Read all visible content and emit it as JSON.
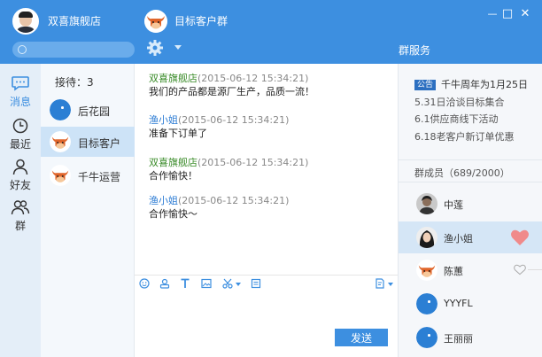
{
  "header": {
    "shop_name": "双喜旗舰店",
    "chat_title": "目标客户群",
    "group_service": "群服务",
    "window_controls": {
      "settings": "⚙",
      "minimize": "—",
      "maximize": "□",
      "close": "✕"
    }
  },
  "nav": {
    "items": [
      {
        "label": "消息",
        "icon": "message-icon"
      },
      {
        "label": "最近",
        "icon": "clock-icon"
      },
      {
        "label": "好友",
        "icon": "friend-icon"
      },
      {
        "label": "群",
        "icon": "group-icon"
      }
    ],
    "active_index": 0
  },
  "conversations": {
    "reception": "接待：3",
    "items": [
      {
        "label": "后花园",
        "avatar": "bird"
      },
      {
        "label": "目标客户",
        "avatar": "ox"
      },
      {
        "label": "千牛运营",
        "avatar": "ox"
      }
    ],
    "active_index": 1
  },
  "messages": [
    {
      "sender": "双喜旗舰店",
      "sender_type": "shop",
      "time": "(2015-06-12 15:34:21)",
      "text": "我们的产品都是源厂生产，品质一流！"
    },
    {
      "sender": "渔小姐",
      "sender_type": "user",
      "time": "(2015-06-12 15:34:21)",
      "text": "准备下订单了"
    },
    {
      "sender": "双喜旗舰店",
      "sender_type": "shop",
      "time": "(2015-06-12 15:34:21)",
      "text": "合作愉快！"
    },
    {
      "sender": "渔小姐",
      "sender_type": "user",
      "time": "(2015-06-12 15:34:21)",
      "text": "合作愉快～"
    }
  ],
  "composer": {
    "send_label": "发送",
    "tools": [
      "emoji-icon",
      "contact-card-icon",
      "text-format-icon",
      "image-icon",
      "screenshot-icon",
      "history-icon",
      "quick-phrase-icon"
    ]
  },
  "notice": {
    "badge": "公告",
    "title": "千牛周年为1月25日",
    "lines": [
      "5.31日洽谈目标集合",
      "6.1供应商线下活动",
      "6.18老客户新订单优惠"
    ]
  },
  "members": {
    "header": "群成员（689/2000）",
    "items": [
      {
        "name": "中莲",
        "avatar": "photo-man"
      },
      {
        "name": "渔小姐",
        "avatar": "photo-woman"
      },
      {
        "name": "陈蕙",
        "avatar": "ox"
      },
      {
        "name": "YYYFL",
        "avatar": "bird"
      },
      {
        "name": "王丽丽",
        "avatar": "bird"
      }
    ],
    "active_index": 1
  },
  "colors": {
    "primary": "#3d8fe0",
    "shop_name": "#3b8c2a",
    "user_name": "#2c7cd4",
    "heart": "#f08a8a"
  }
}
